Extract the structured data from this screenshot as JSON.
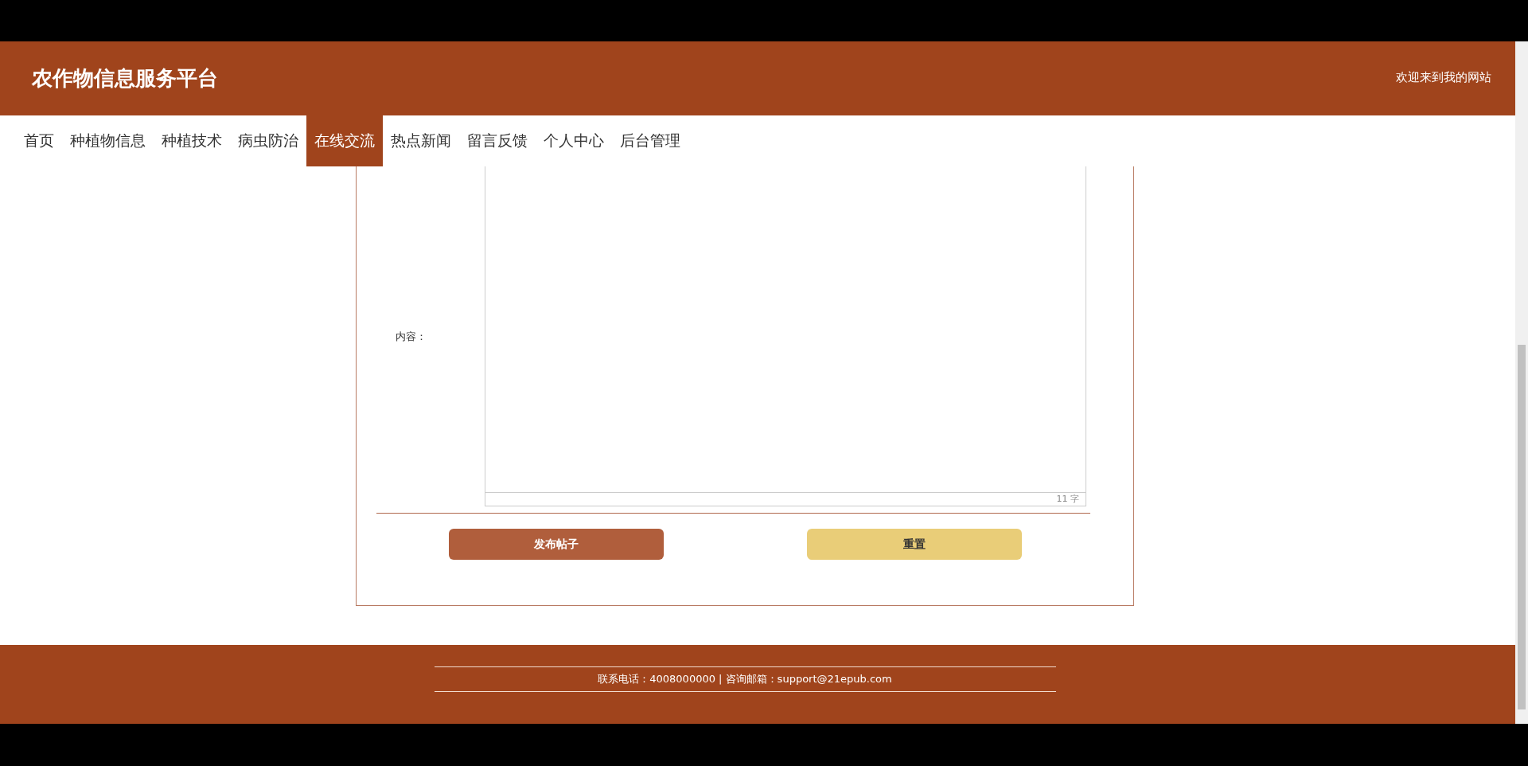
{
  "header": {
    "title": "农作物信息服务平台",
    "welcome": "欢迎来到我的网站"
  },
  "nav": [
    {
      "label": "首页",
      "selected": false
    },
    {
      "label": "种植物信息",
      "selected": false
    },
    {
      "label": "种植技术",
      "selected": false
    },
    {
      "label": "病虫防治",
      "selected": false
    },
    {
      "label": "在线交流",
      "selected": true
    },
    {
      "label": "热点新闻",
      "selected": false
    },
    {
      "label": "留言反馈",
      "selected": false
    },
    {
      "label": "个人中心",
      "selected": false
    },
    {
      "label": "后台管理",
      "selected": false
    }
  ],
  "form": {
    "content_label": "内容：",
    "word_count": "11 字",
    "buttons": [
      {
        "label": "发布帖子",
        "kind": "primary"
      },
      {
        "label": "重置",
        "kind": "secondary"
      }
    ]
  },
  "footer": {
    "contact": "联系电话：4008000000 | 咨询邮箱：support@21epub.com"
  }
}
